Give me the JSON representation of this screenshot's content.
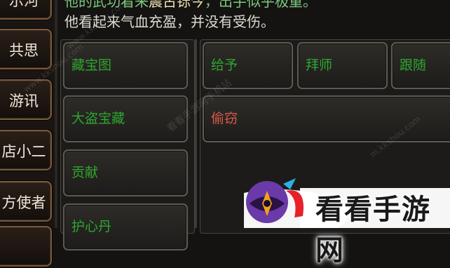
{
  "sidebar": {
    "items": [
      {
        "label": "示河"
      },
      {
        "label": "共思"
      },
      {
        "label": "游讯"
      },
      {
        "label": "店小二"
      },
      {
        "label": "方使者"
      },
      {
        "label": ""
      }
    ]
  },
  "story": {
    "line1_a": "他的武功看来",
    "line1_hl": "震古铄今",
    "line1_b": "，出手似乎极重。",
    "line2": "他看起来气血充盈，并没有受伤。"
  },
  "left_panel": {
    "buttons": [
      {
        "label": "藏宝图"
      },
      {
        "label": "大盗宝藏"
      },
      {
        "label": "贡献"
      },
      {
        "label": "护心丹"
      }
    ]
  },
  "right_panel": {
    "buttons": [
      {
        "label": "给予"
      },
      {
        "label": "拜师"
      },
      {
        "label": "跟随"
      }
    ],
    "steal_button": {
      "label": "偷窃"
    }
  },
  "watermark": {
    "url_a": "www.kkshou.com",
    "url_b": "www.kkshou.com",
    "mobile": "看看手游网手机站",
    "url_c": "m.kkshou.com",
    "logo_text": "看看手游网"
  },
  "colors": {
    "action_text": "#2fa52f",
    "danger_text": "#e0584a",
    "highlight_text": "#e9e2b0"
  }
}
